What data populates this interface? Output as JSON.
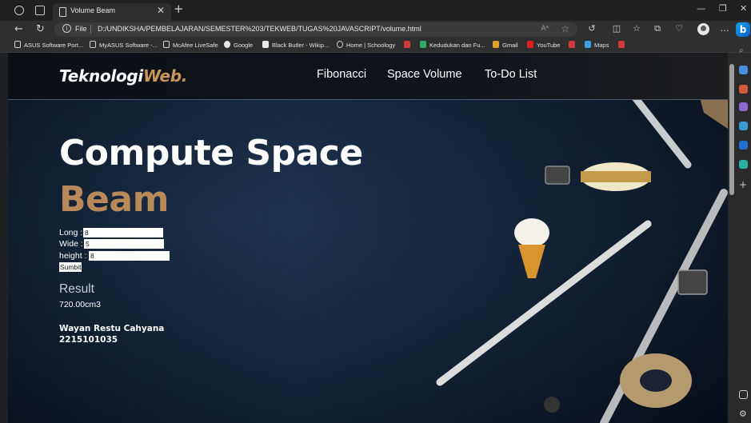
{
  "browser": {
    "tab_title": "Volume Beam",
    "tab_close": "✕",
    "new_tab": "+",
    "file_label": "File",
    "url": "D:/UNDIKSHA/PEMBELAJARAN/SEMESTER%203/TEKWEB/TUGAS%20JAVASCRIPT/volume.html",
    "bookmarks": [
      {
        "label": "ASUS Software Port..."
      },
      {
        "label": "MyASUS Software -..."
      },
      {
        "label": "McAfee LiveSafe"
      },
      {
        "label": "Google"
      },
      {
        "label": "Black Butler - Wikip..."
      },
      {
        "label": "Home | Schoology"
      },
      {
        "label": "Kedudukan dan Fu..."
      },
      {
        "label": "Gmail"
      },
      {
        "label": "YouTube"
      },
      {
        "label": "Maps"
      }
    ]
  },
  "site": {
    "logo_main": "Teknologi",
    "logo_accent": "Web.",
    "nav": [
      {
        "label": "Fibonacci"
      },
      {
        "label": "Space Volume"
      },
      {
        "label": "To-Do List"
      }
    ],
    "hero_line1": "Compute Space",
    "hero_line2": "Beam",
    "form": {
      "long_label": "Long :",
      "long_value": "8",
      "wide_label": "Wide :",
      "wide_value": "5",
      "height_label": "height :",
      "height_value": "8",
      "submit_label": "Sumbit"
    },
    "result_label": "Result",
    "result_value": "720.00cm3",
    "author_name": "Wayan Restu Cahyana",
    "author_id": "2215101035"
  },
  "colors": {
    "accent": "#c8955a",
    "hero_accent": "#b88a5a",
    "background": "#17283f"
  }
}
